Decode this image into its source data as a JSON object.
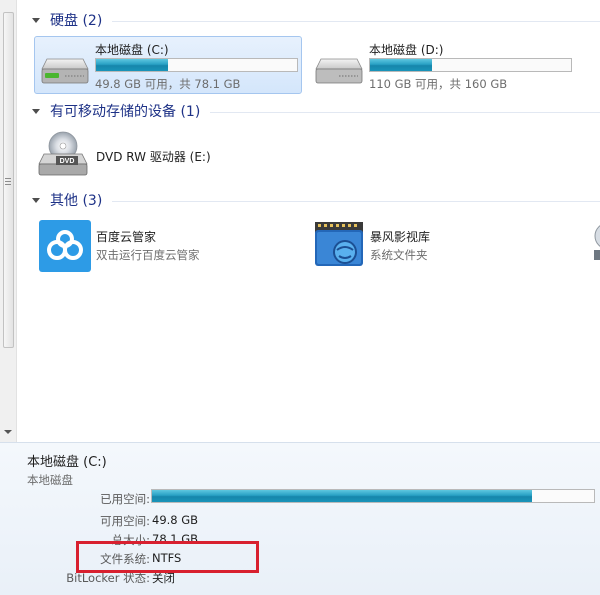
{
  "groups": {
    "hard_disks": {
      "title": "硬盘 (2)"
    },
    "removable": {
      "title": "有可移动存储的设备 (1)"
    },
    "other": {
      "title": "其他 (3)"
    }
  },
  "drives": [
    {
      "name": "本地磁盘 (C:)",
      "free_text": "49.8 GB 可用，共 78.1 GB",
      "used_fraction": 0.36,
      "selected": true
    },
    {
      "name": "本地磁盘 (D:)",
      "free_text": "110 GB 可用，共 160 GB",
      "used_fraction": 0.31,
      "selected": false
    }
  ],
  "removable_items": [
    {
      "name": "DVD RW 驱动器 (E:)",
      "icon_label": "DVD"
    }
  ],
  "other_items": [
    {
      "name": "百度云管家",
      "subtitle": "双击运行百度云管家"
    },
    {
      "name": "暴风影视库",
      "subtitle": "系统文件夹"
    }
  ],
  "details": {
    "title": "本地磁盘 (C:)",
    "type": "本地磁盘",
    "used_label": "已用空间:",
    "used_fraction": 0.86,
    "free_label": "可用空间:",
    "free_value": "49.8 GB",
    "total_label": "总大小:",
    "total_value": "78.1 GB",
    "fs_label": "文件系统:",
    "fs_value": "NTFS",
    "bitlocker_label": "BitLocker 状态:",
    "bitlocker_value": "关闭"
  },
  "colors": {
    "group_title": "#1e3287",
    "bar_fill": "#1994b9",
    "selection": "#d4e6fb",
    "highlight_box": "#d8202f"
  }
}
